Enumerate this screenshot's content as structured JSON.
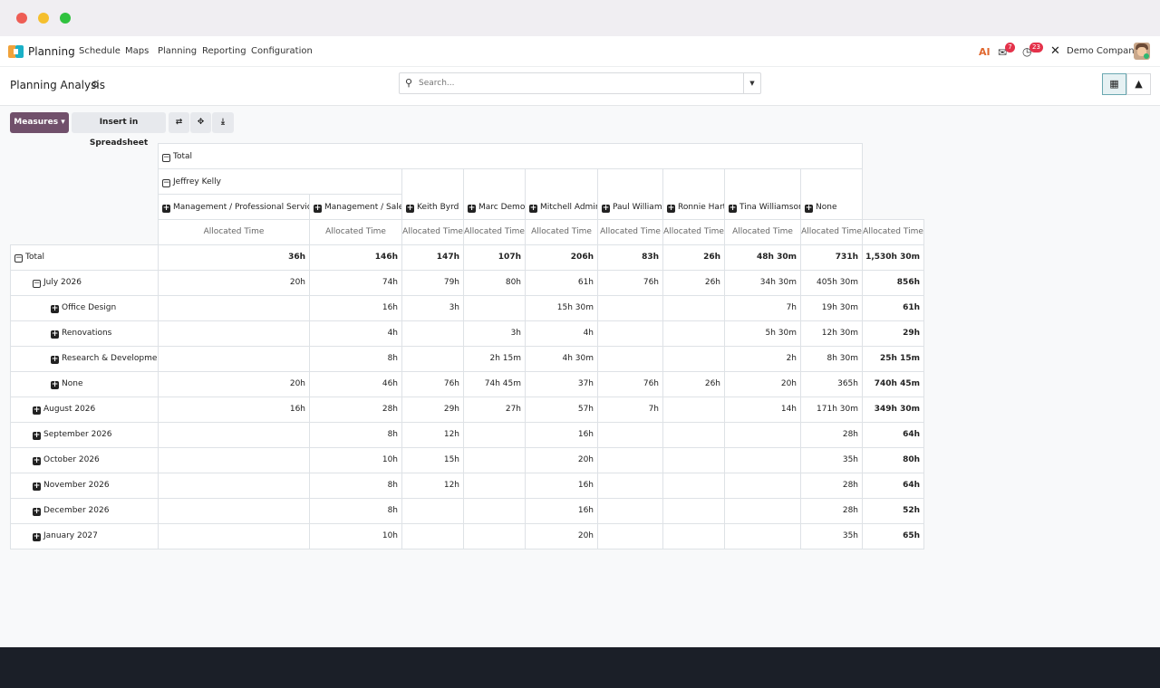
{
  "window": {
    "controls": [
      "close",
      "minimize",
      "maximize"
    ]
  },
  "navbar": {
    "app_name": "Planning",
    "menu": [
      "Schedule",
      "Maps",
      "Planning",
      "Reporting",
      "Configuration"
    ],
    "ai_icon": "AI",
    "chat_badge": "7",
    "activity_badge": "23",
    "company": "Demo Company"
  },
  "control": {
    "breadcrumb": "Planning Analysis",
    "search_placeholder": "Search..."
  },
  "toolbar": {
    "measures_label": "Measures",
    "insert_label": "Insert in Spreadsheet"
  },
  "pivot": {
    "col_total": "Total",
    "col_group": "Jeffrey Kelly",
    "columns": [
      "Management / Professional Services",
      "Management / Sales",
      "Keith Byrd",
      "Marc Demo",
      "Mitchell Admin",
      "Paul Williams",
      "Ronnie Hart",
      "Tina Williamson",
      "None"
    ],
    "measure": "Allocated Time",
    "rows": [
      {
        "label": "Total",
        "values": [
          "36h",
          "146h",
          "147h",
          "107h",
          "206h",
          "83h",
          "26h",
          "48h 30m",
          "731h",
          "1,530h 30m"
        ]
      },
      {
        "label": "July 2026",
        "values": [
          "20h",
          "74h",
          "79h",
          "80h",
          "61h",
          "76h",
          "26h",
          "34h 30m",
          "405h 30m",
          "856h"
        ]
      },
      {
        "label": "Office Design",
        "values": [
          "",
          "16h",
          "3h",
          "",
          "15h 30m",
          "",
          "",
          "7h",
          "19h 30m",
          "61h"
        ]
      },
      {
        "label": "Renovations",
        "values": [
          "",
          "4h",
          "",
          "3h",
          "4h",
          "",
          "",
          "5h 30m",
          "12h 30m",
          "29h"
        ]
      },
      {
        "label": "Research & Development",
        "values": [
          "",
          "8h",
          "",
          "2h 15m",
          "4h 30m",
          "",
          "",
          "2h",
          "8h 30m",
          "25h 15m"
        ]
      },
      {
        "label": "None",
        "values": [
          "20h",
          "46h",
          "76h",
          "74h 45m",
          "37h",
          "76h",
          "26h",
          "20h",
          "365h",
          "740h 45m"
        ]
      },
      {
        "label": "August 2026",
        "values": [
          "16h",
          "28h",
          "29h",
          "27h",
          "57h",
          "7h",
          "",
          "14h",
          "171h 30m",
          "349h 30m"
        ]
      },
      {
        "label": "September 2026",
        "values": [
          "",
          "8h",
          "12h",
          "",
          "16h",
          "",
          "",
          "",
          "28h",
          "64h"
        ]
      },
      {
        "label": "October 2026",
        "values": [
          "",
          "10h",
          "15h",
          "",
          "20h",
          "",
          "",
          "",
          "35h",
          "80h"
        ]
      },
      {
        "label": "November 2026",
        "values": [
          "",
          "8h",
          "12h",
          "",
          "16h",
          "",
          "",
          "",
          "28h",
          "64h"
        ]
      },
      {
        "label": "December 2026",
        "values": [
          "",
          "8h",
          "",
          "",
          "16h",
          "",
          "",
          "",
          "28h",
          "52h"
        ]
      },
      {
        "label": "January 2027",
        "values": [
          "",
          "10h",
          "",
          "",
          "20h",
          "",
          "",
          "",
          "35h",
          "65h"
        ]
      }
    ]
  }
}
